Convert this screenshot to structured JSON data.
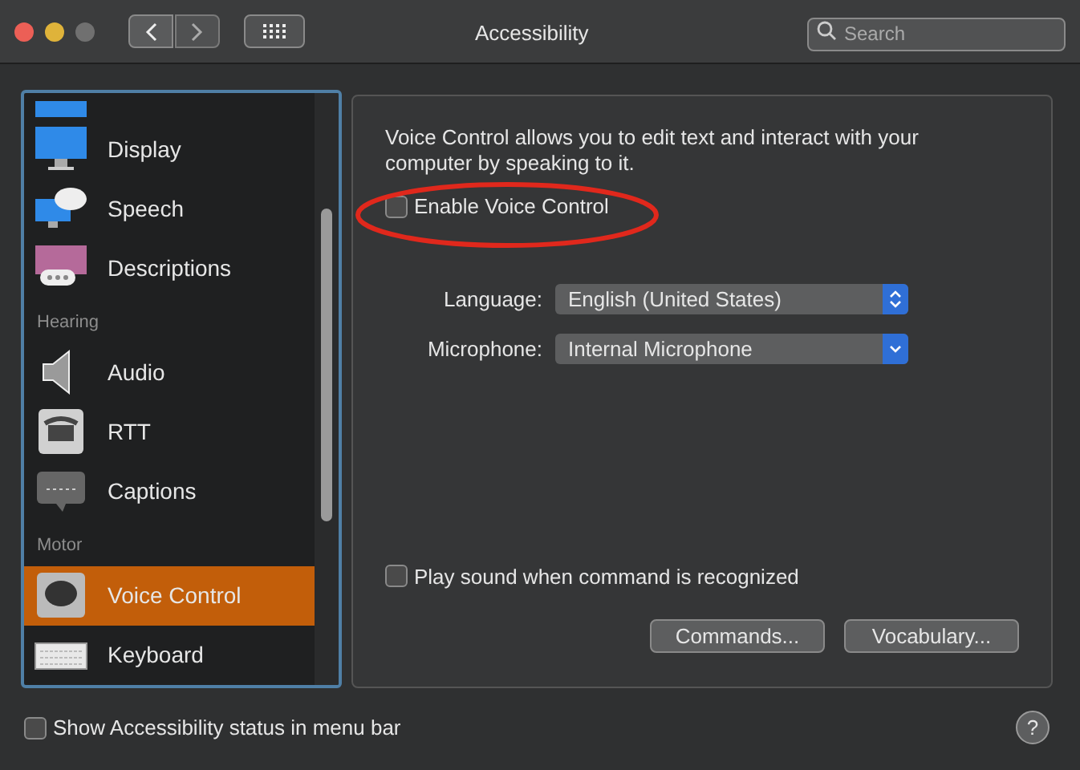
{
  "window": {
    "title": "Accessibility"
  },
  "search": {
    "placeholder": "Search"
  },
  "sidebar": {
    "items": [
      {
        "kind": "item",
        "label": "Display",
        "selected": false
      },
      {
        "kind": "item",
        "label": "Speech",
        "selected": false
      },
      {
        "kind": "item",
        "label": "Descriptions",
        "selected": false
      },
      {
        "kind": "header",
        "label": "Hearing"
      },
      {
        "kind": "item",
        "label": "Audio",
        "selected": false
      },
      {
        "kind": "item",
        "label": "RTT",
        "selected": false
      },
      {
        "kind": "item",
        "label": "Captions",
        "selected": false
      },
      {
        "kind": "header",
        "label": "Motor"
      },
      {
        "kind": "item",
        "label": "Voice Control",
        "selected": true
      },
      {
        "kind": "item",
        "label": "Keyboard",
        "selected": false
      }
    ]
  },
  "panel": {
    "description": "Voice Control allows you to edit text and interact with your computer by speaking to it.",
    "enable": {
      "label": "Enable Voice Control",
      "checked": false
    },
    "fields": [
      {
        "kind": "stepper",
        "label": "Language:",
        "value": "English (United States)"
      },
      {
        "kind": "dropdown",
        "label": "Microphone:",
        "value": "Internal Microphone"
      }
    ],
    "play_sound": {
      "label": "Play sound when command is recognized",
      "checked": false
    },
    "buttons": [
      "Commands...",
      "Vocabulary..."
    ]
  },
  "status": {
    "label": "Show Accessibility status in menu bar",
    "checked": false
  },
  "help": "?"
}
